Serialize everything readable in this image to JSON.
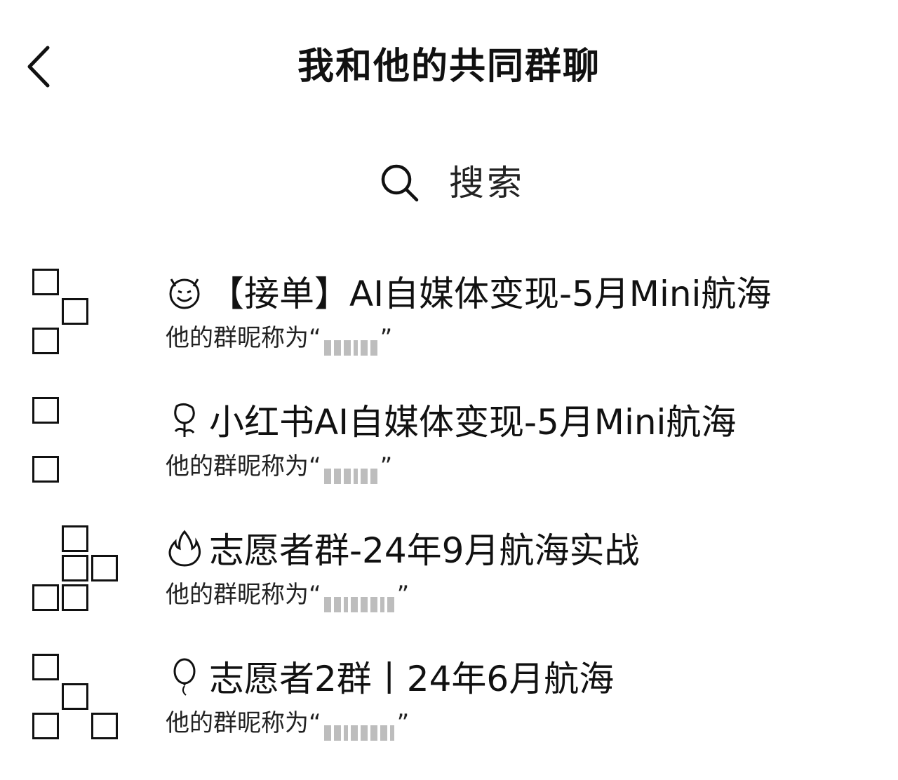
{
  "header": {
    "title": "我和他的共同群聊",
    "back_icon": "chevron-left-icon"
  },
  "search": {
    "placeholder": "搜索",
    "icon": "search-icon"
  },
  "groups": [
    {
      "emoji_icon": "smiling-devil-icon",
      "name": "【接单】AI自媒体变现-5月Mini航海",
      "nickname_prefix": "他的群昵称为“",
      "nickname_suffix": "”"
    },
    {
      "emoji_icon": "rose-icon",
      "name": "小红书AI自媒体变现-5月Mini航海",
      "nickname_prefix": "他的群昵称为“",
      "nickname_suffix": "”"
    },
    {
      "emoji_icon": "fire-icon",
      "name": "志愿者群-24年9月航海实战",
      "nickname_prefix": "他的群昵称为“",
      "nickname_suffix": "”"
    },
    {
      "emoji_icon": "balloon-icon",
      "name": "志愿者2群丨24年6月航海",
      "nickname_prefix": "他的群昵称为“",
      "nickname_suffix": "”"
    }
  ]
}
